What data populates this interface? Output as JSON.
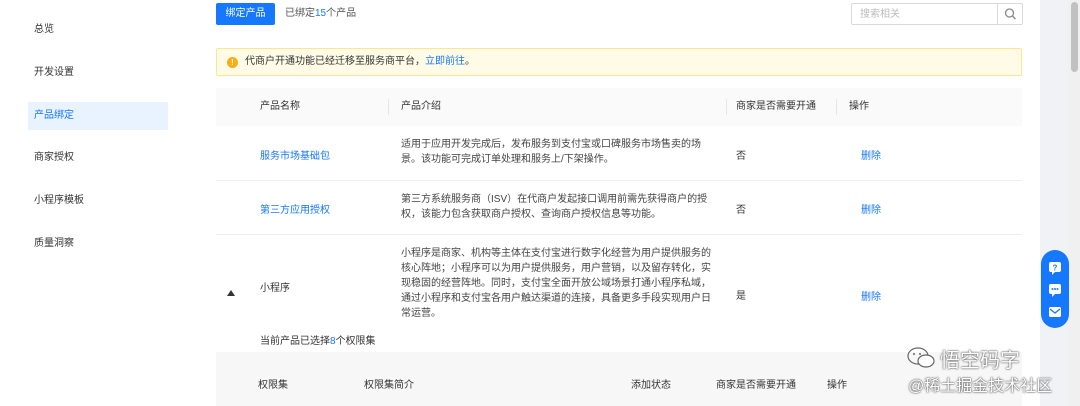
{
  "sidebar": {
    "items": [
      {
        "label": "总览",
        "active": false
      },
      {
        "label": "开发设置",
        "active": false
      },
      {
        "label": "产品绑定",
        "active": true
      },
      {
        "label": "商家授权",
        "active": false
      },
      {
        "label": "小程序模板",
        "active": false
      },
      {
        "label": "质量洞察",
        "active": false
      }
    ]
  },
  "toolbar": {
    "bind_button": "绑定产品",
    "bound_prefix": "已绑定",
    "bound_count": "15",
    "bound_suffix": "个产品",
    "search_placeholder": "搜索相关"
  },
  "notice": {
    "text": "代商户开通功能已经迁移至服务商平台，",
    "link": "立即前往",
    "end": "。"
  },
  "table": {
    "headers": [
      "产品名称",
      "产品介绍",
      "商家是否需要开通",
      "操作"
    ],
    "rows": [
      {
        "name": "服务市场基础包",
        "desc": "适用于应用开发完成后，发布服务到支付宝或口碑服务市场售卖的场景。该功能可完成订单处理和服务上/下架操作。",
        "need": "否",
        "action": "删除",
        "is_link": true
      },
      {
        "name": "第三方应用授权",
        "desc": "第三方系统服务商（ISV）在代商户发起接口调用前需先获得商户的授权，该能力包含获取商户授权、查询商户授权信息等功能。",
        "need": "否",
        "action": "删除",
        "is_link": true
      },
      {
        "name": "小程序",
        "desc": "小程序是商家、机构等主体在支付宝进行数字化经营为用户提供服务的核心阵地；小程序可以为用户提供服务，用户营销，以及留存转化，实现稳固的经营阵地。同时，支付宝全面开放公域场景打通小程序私域，通过小程序和支付宝各用户触达渠道的连接，具备更多手段实现用户日常运营。",
        "need": "是",
        "action": "删除",
        "is_link": false
      }
    ],
    "expanded": {
      "selected_prefix": "当前产品已选择",
      "selected_count": "8",
      "selected_suffix": "个权限集",
      "sub_headers": [
        "权限集",
        "权限集简介",
        "添加状态",
        "商家是否需要开通",
        "操作"
      ]
    }
  },
  "watermark": {
    "line1": "悟空码字",
    "line2": "@稀土掘金技术社区"
  },
  "colors": {
    "accent": "#1677ff",
    "notice_bg": "#fffbe6",
    "notice_icon": "#faad14"
  }
}
